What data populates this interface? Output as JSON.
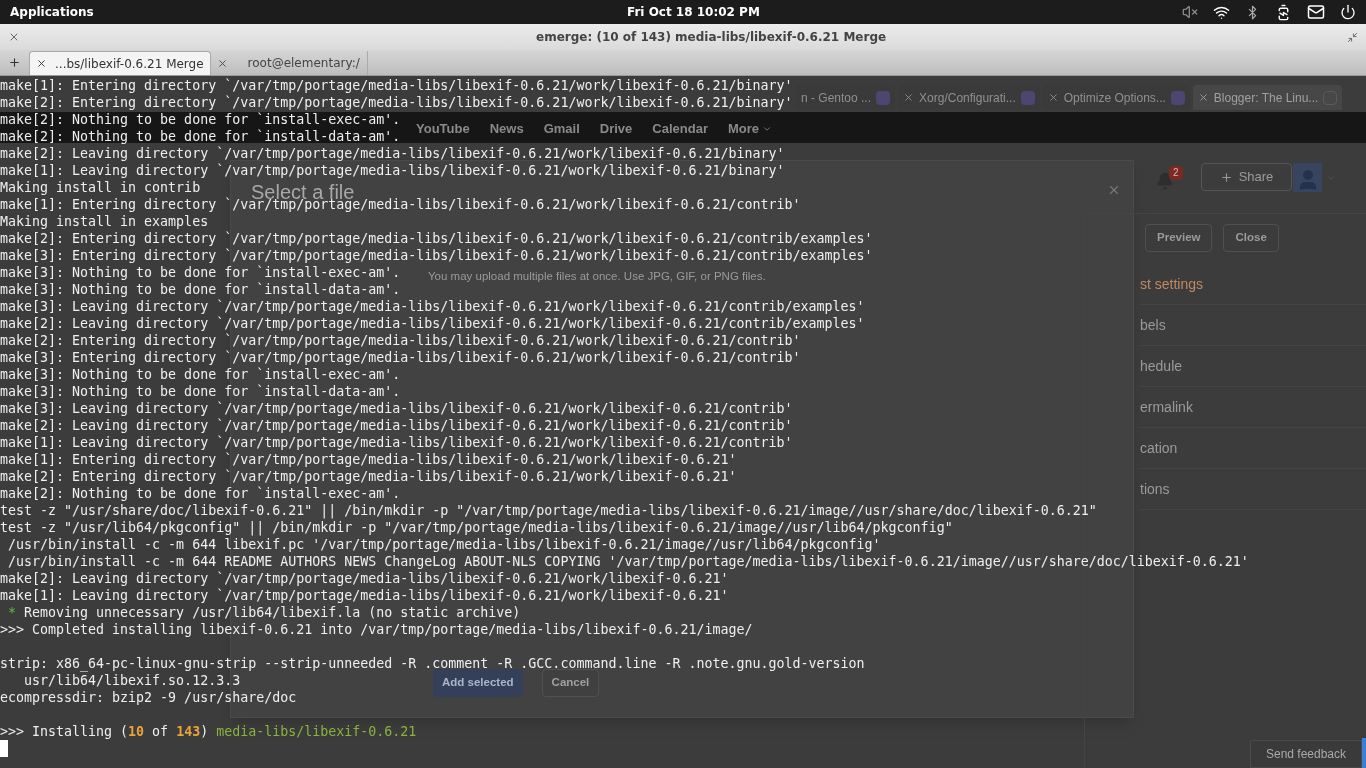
{
  "top_panel": {
    "menu": "Applications",
    "clock": "Fri Oct 18 10:02 PM"
  },
  "terminal": {
    "title": "emerge: (10 of 143) media-libs/libexif-0.6.21 Merge",
    "tabs": [
      {
        "label": "...bs/libexif-0.6.21 Merge",
        "selected": true
      },
      {
        "label": "root@elementary:/",
        "selected": false
      }
    ],
    "lines": [
      {
        "kind": "text",
        "text": "make[1]: Entering directory `/var/tmp/portage/media-libs/libexif-0.6.21/work/libexif-0.6.21/binary'"
      },
      {
        "kind": "text",
        "text": "make[2]: Entering directory `/var/tmp/portage/media-libs/libexif-0.6.21/work/libexif-0.6.21/binary'"
      },
      {
        "kind": "text",
        "text": "make[2]: Nothing to be done for `install-exec-am'."
      },
      {
        "kind": "text",
        "text": "make[2]: Nothing to be done for `install-data-am'."
      },
      {
        "kind": "text",
        "text": "make[2]: Leaving directory `/var/tmp/portage/media-libs/libexif-0.6.21/work/libexif-0.6.21/binary'"
      },
      {
        "kind": "text",
        "text": "make[1]: Leaving directory `/var/tmp/portage/media-libs/libexif-0.6.21/work/libexif-0.6.21/binary'"
      },
      {
        "kind": "text",
        "text": "Making install in contrib"
      },
      {
        "kind": "text",
        "text": "make[1]: Entering directory `/var/tmp/portage/media-libs/libexif-0.6.21/work/libexif-0.6.21/contrib'"
      },
      {
        "kind": "text",
        "text": "Making install in examples"
      },
      {
        "kind": "text",
        "text": "make[2]: Entering directory `/var/tmp/portage/media-libs/libexif-0.6.21/work/libexif-0.6.21/contrib/examples'"
      },
      {
        "kind": "text",
        "text": "make[3]: Entering directory `/var/tmp/portage/media-libs/libexif-0.6.21/work/libexif-0.6.21/contrib/examples'"
      },
      {
        "kind": "text",
        "text": "make[3]: Nothing to be done for `install-exec-am'."
      },
      {
        "kind": "text",
        "text": "make[3]: Nothing to be done for `install-data-am'."
      },
      {
        "kind": "text",
        "text": "make[3]: Leaving directory `/var/tmp/portage/media-libs/libexif-0.6.21/work/libexif-0.6.21/contrib/examples'"
      },
      {
        "kind": "text",
        "text": "make[2]: Leaving directory `/var/tmp/portage/media-libs/libexif-0.6.21/work/libexif-0.6.21/contrib/examples'"
      },
      {
        "kind": "text",
        "text": "make[2]: Entering directory `/var/tmp/portage/media-libs/libexif-0.6.21/work/libexif-0.6.21/contrib'"
      },
      {
        "kind": "text",
        "text": "make[3]: Entering directory `/var/tmp/portage/media-libs/libexif-0.6.21/work/libexif-0.6.21/contrib'"
      },
      {
        "kind": "text",
        "text": "make[3]: Nothing to be done for `install-exec-am'."
      },
      {
        "kind": "text",
        "text": "make[3]: Nothing to be done for `install-data-am'."
      },
      {
        "kind": "text",
        "text": "make[3]: Leaving directory `/var/tmp/portage/media-libs/libexif-0.6.21/work/libexif-0.6.21/contrib'"
      },
      {
        "kind": "text",
        "text": "make[2]: Leaving directory `/var/tmp/portage/media-libs/libexif-0.6.21/work/libexif-0.6.21/contrib'"
      },
      {
        "kind": "text",
        "text": "make[1]: Leaving directory `/var/tmp/portage/media-libs/libexif-0.6.21/work/libexif-0.6.21/contrib'"
      },
      {
        "kind": "text",
        "text": "make[1]: Entering directory `/var/tmp/portage/media-libs/libexif-0.6.21/work/libexif-0.6.21'"
      },
      {
        "kind": "text",
        "text": "make[2]: Entering directory `/var/tmp/portage/media-libs/libexif-0.6.21/work/libexif-0.6.21'"
      },
      {
        "kind": "text",
        "text": "make[2]: Nothing to be done for `install-exec-am'."
      },
      {
        "kind": "text",
        "text": "test -z \"/usr/share/doc/libexif-0.6.21\" || /bin/mkdir -p \"/var/tmp/portage/media-libs/libexif-0.6.21/image//usr/share/doc/libexif-0.6.21\""
      },
      {
        "kind": "text",
        "text": "test -z \"/usr/lib64/pkgconfig\" || /bin/mkdir -p \"/var/tmp/portage/media-libs/libexif-0.6.21/image//usr/lib64/pkgconfig\""
      },
      {
        "kind": "text",
        "text": " /usr/bin/install -c -m 644 libexif.pc '/var/tmp/portage/media-libs/libexif-0.6.21/image//usr/lib64/pkgconfig'"
      },
      {
        "kind": "text",
        "text": " /usr/bin/install -c -m 644 README AUTHORS NEWS ChangeLog ABOUT-NLS COPYING '/var/tmp/portage/media-libs/libexif-0.6.21/image//usr/share/doc/libexif-0.6.21'"
      },
      {
        "kind": "text",
        "text": "make[2]: Leaving directory `/var/tmp/portage/media-libs/libexif-0.6.21/work/libexif-0.6.21'"
      },
      {
        "kind": "text",
        "text": "make[1]: Leaving directory `/var/tmp/portage/media-libs/libexif-0.6.21/work/libexif-0.6.21'"
      },
      {
        "kind": "styled",
        "segments": [
          {
            "kind": "bullet",
            "text": " *"
          },
          {
            "kind": "plain",
            "text": " Removing unnecessary /usr/lib64/libexif.la (no static archive)"
          }
        ]
      },
      {
        "kind": "text",
        "text": ">>> Completed installing libexif-0.6.21 into /var/tmp/portage/media-libs/libexif-0.6.21/image/"
      },
      {
        "kind": "blank"
      },
      {
        "kind": "text",
        "text": "strip: x86_64-pc-linux-gnu-strip --strip-unneeded -R .comment -R .GCC.command.line -R .note.gnu.gold-version"
      },
      {
        "kind": "text",
        "text": "   usr/lib64/libexif.so.12.3.3"
      },
      {
        "kind": "text",
        "text": "ecompressdir: bzip2 -9 /usr/share/doc"
      },
      {
        "kind": "blank"
      },
      {
        "kind": "styled",
        "segments": [
          {
            "kind": "plain",
            "text": ">>> Installing ("
          },
          {
            "kind": "number",
            "text": "10"
          },
          {
            "kind": "plain",
            "text": " of "
          },
          {
            "kind": "number",
            "text": "143"
          },
          {
            "kind": "plain",
            "text": ") "
          },
          {
            "kind": "package",
            "text": "media-libs/libexif-0.6.21"
          }
        ]
      }
    ]
  },
  "browser": {
    "tabs": [
      {
        "label": "n - Gentoo ...",
        "selected": false
      },
      {
        "label": "Xorg/Configurati...",
        "selected": false
      },
      {
        "label": "Optimize Options...",
        "selected": false
      },
      {
        "label": "Blogger: The Linu...",
        "selected": true
      }
    ],
    "google_bar": [
      "YouTube",
      "News",
      "Gmail",
      "Drive",
      "Calendar",
      "More"
    ],
    "notification_count": "2",
    "share": "Share",
    "editor_buttons": [
      "Preview",
      "Close"
    ],
    "sidebar": [
      "st settings",
      "bels",
      "hedule",
      "ermalink",
      "cation",
      "tions"
    ],
    "dialog": {
      "title": "Select a file",
      "hint": "You may upload multiple files at once. Use JPG, GIF, or PNG files.",
      "buttons": [
        {
          "label": "Add selected",
          "kind": "primary"
        },
        {
          "label": "Cancel",
          "kind": "secondary"
        }
      ]
    },
    "feedback": "Send feedback"
  }
}
